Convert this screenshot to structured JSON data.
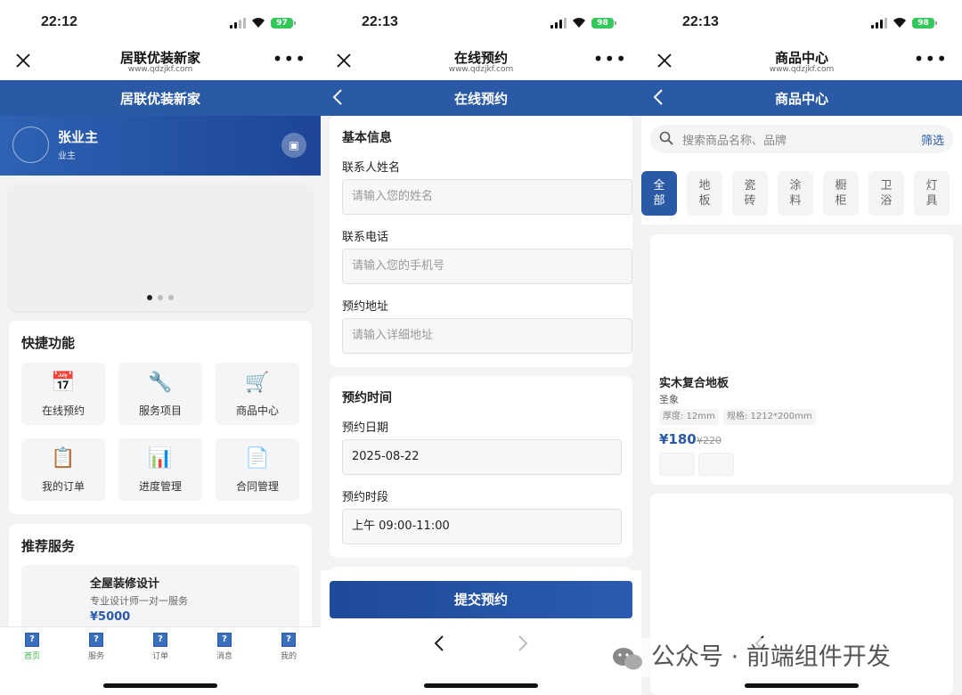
{
  "screens": {
    "home": {
      "status_time": "22:12",
      "battery": "97",
      "mp_title": "居联优装新家",
      "mp_url": "www.qdzjkf.com",
      "nav_title": "居联优装新家",
      "user": {
        "name": "张业主",
        "role": "业主"
      },
      "quick": {
        "title": "快捷功能",
        "items": [
          {
            "label": "在线预约",
            "icon": "calendar-icon"
          },
          {
            "label": "服务项目",
            "icon": "wrench-icon"
          },
          {
            "label": "商品中心",
            "icon": "cart-icon"
          },
          {
            "label": "我的订单",
            "icon": "clipboard-icon"
          },
          {
            "label": "进度管理",
            "icon": "bar-chart-icon"
          },
          {
            "label": "合同管理",
            "icon": "document-icon"
          }
        ]
      },
      "recommend": {
        "title": "推荐服务",
        "service": {
          "title": "全屋装修设计",
          "desc": "专业设计师一对一服务",
          "price": "¥5000"
        }
      },
      "tabbar": [
        {
          "label": "首页",
          "active": true
        },
        {
          "label": "服务",
          "active": false
        },
        {
          "label": "订单",
          "active": false
        },
        {
          "label": "消息",
          "active": false
        },
        {
          "label": "我的",
          "active": false
        }
      ]
    },
    "booking": {
      "status_time": "22:13",
      "battery": "98",
      "mp_title": "在线预约",
      "mp_url": "www.qdzjkf.com",
      "nav_title": "在线预约",
      "basic": {
        "title": "基本信息",
        "name_label": "联系人姓名",
        "name_placeholder": "请输入您的姓名",
        "phone_label": "联系电话",
        "phone_placeholder": "请输入您的手机号",
        "address_label": "预约地址",
        "address_placeholder": "请输入详细地址"
      },
      "time": {
        "title": "预约时间",
        "date_label": "预约日期",
        "date_value": "2025-08-22",
        "slot_label": "预约时段",
        "slot_value": "上午 09:00-11:00"
      },
      "submit_label": "提交预约"
    },
    "products": {
      "status_time": "22:13",
      "battery": "98",
      "mp_title": "商品中心",
      "mp_url": "www.qdzjkf.com",
      "nav_title": "商品中心",
      "search_placeholder": "搜索商品名称、品牌",
      "filter_label": "筛选",
      "categories": [
        {
          "label": "全部",
          "active": true
        },
        {
          "label": "地板",
          "active": false
        },
        {
          "label": "瓷砖",
          "active": false
        },
        {
          "label": "涂料",
          "active": false
        },
        {
          "label": "橱柜",
          "active": false
        },
        {
          "label": "卫浴",
          "active": false
        },
        {
          "label": "灯具",
          "active": false
        }
      ],
      "product": {
        "title": "实木复合地板",
        "brand": "圣象",
        "tags": [
          "厚度: 12mm",
          "规格: 1212*200mm"
        ],
        "price": "¥180",
        "old_price": "¥220"
      }
    }
  },
  "watermark": "公众号 · 前端组件开发",
  "colors": {
    "primary": "#2a5aa6",
    "active_tab": "#3bb54a",
    "battery": "#34c759"
  }
}
